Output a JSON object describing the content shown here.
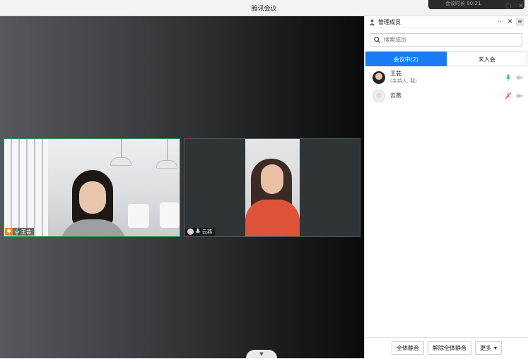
{
  "window": {
    "title": "腾讯会议",
    "top_banner": "会议时长 00:21"
  },
  "videos": [
    {
      "name": "王芸",
      "is_host": true,
      "mic": "on"
    },
    {
      "name": "云燕",
      "is_host": false,
      "mic": "on"
    }
  ],
  "panel": {
    "title": "管理成员",
    "more_icon": "ellipsis-icon",
    "search_placeholder": "搜索成员",
    "tabs": [
      {
        "label": "会议中(2)",
        "active": true
      },
      {
        "label": "未入会",
        "active": false
      }
    ],
    "members": [
      {
        "name": "王芸",
        "role": "(主持人, 我)",
        "mic": "on",
        "camera": "off"
      },
      {
        "name": "云燕",
        "role": "",
        "mic": "muted",
        "camera": "off"
      }
    ],
    "footer": {
      "mute_all": "全体静音",
      "unmute_all": "解除全体静音",
      "more": "更多"
    }
  },
  "colors": {
    "accent": "#1a7cf5",
    "host_border": "#2f8a55",
    "mic_on": "#3ec46d",
    "mic_muted": "#e0533b",
    "host_badge": "#f08a24"
  }
}
